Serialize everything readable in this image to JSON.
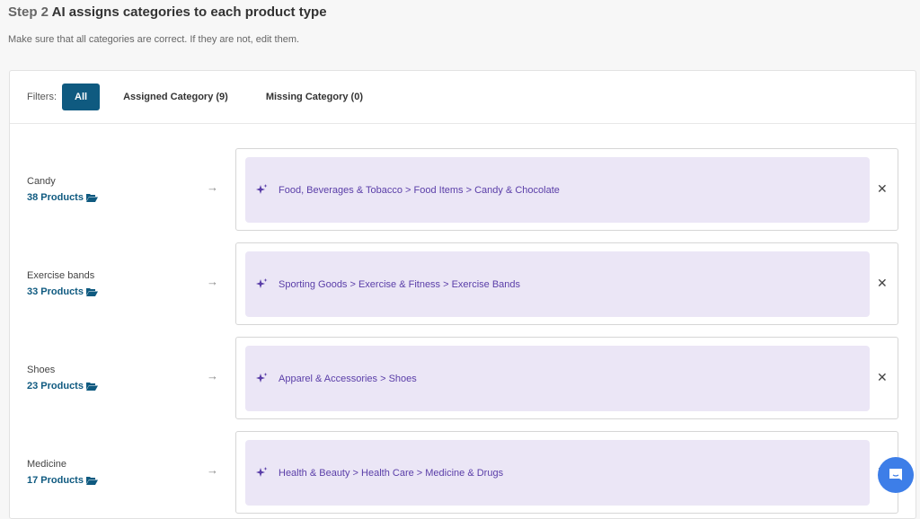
{
  "header": {
    "step": "Step 2",
    "title": "AI assigns categories to each product type",
    "subtitle": "Make sure that all categories are correct. If they are not, edit them."
  },
  "filters": {
    "label": "Filters:",
    "options": [
      "All",
      "Assigned Category (9)",
      "Missing Category (0)"
    ],
    "active": "All"
  },
  "rows": [
    {
      "type": "Candy",
      "count": "38 Products",
      "category": "Food, Beverages & Tobacco > Food Items > Candy & Chocolate"
    },
    {
      "type": "Exercise bands",
      "count": "33 Products",
      "category": "Sporting Goods > Exercise & Fitness > Exercise Bands"
    },
    {
      "type": "Shoes",
      "count": "23 Products",
      "category": "Apparel & Accessories > Shoes"
    },
    {
      "type": "Medicine",
      "count": "17 Products",
      "category": "Health & Beauty > Health Care > Medicine & Drugs"
    }
  ],
  "icons": {
    "arrow": "arrow-right-icon",
    "sparkle": "sparkle-icon",
    "close": "close-icon",
    "folder": "folder-open-icon",
    "chat": "chat-icon"
  },
  "colors": {
    "primary": "#0f5a80",
    "category_bg": "#ebe6f6",
    "category_text": "#5a3ea8",
    "chat": "#3d7ee8"
  }
}
